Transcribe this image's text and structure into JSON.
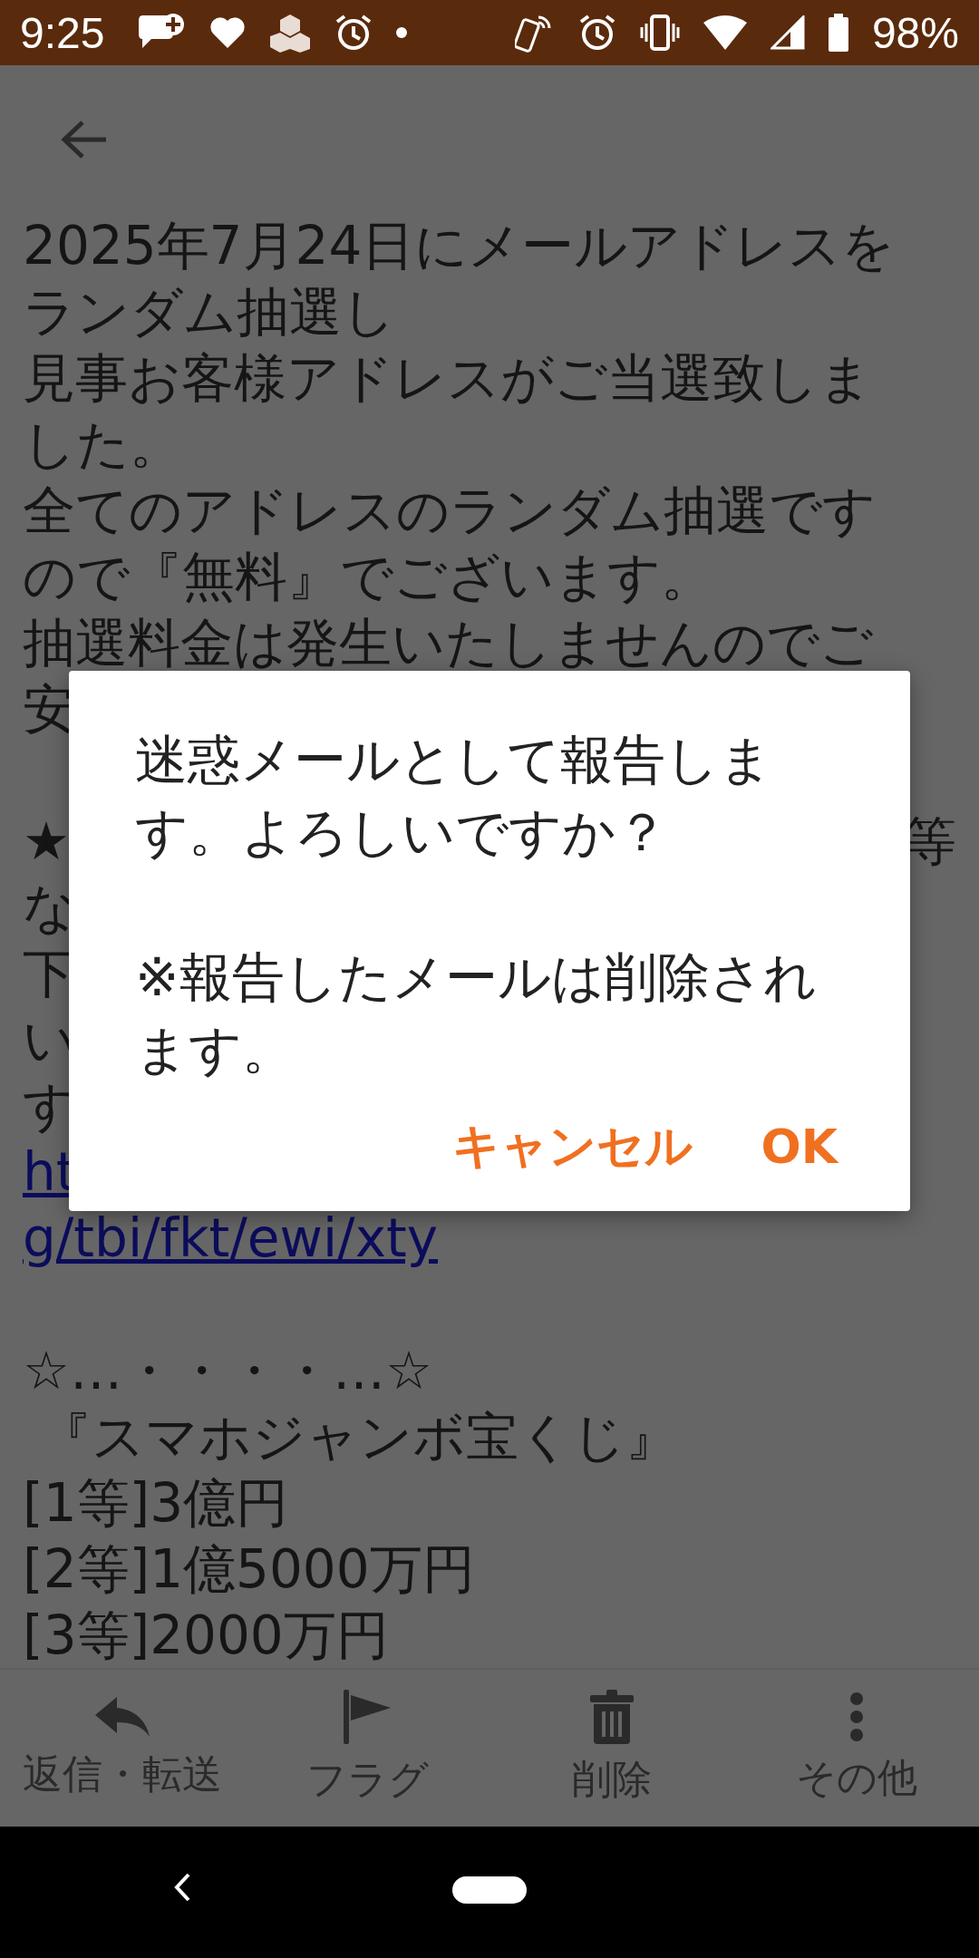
{
  "status_bar": {
    "time": "9:25",
    "battery": "98%"
  },
  "body": {
    "paragraphs": [
      [
        {
          "text": "2025年7月24日にメールアドレスを",
          "link": false
        },
        {
          "text": "ランダム抽選し",
          "link": false
        },
        {
          "text": "見事お客様アドレスがご当選致しま",
          "link": false
        },
        {
          "text": "した。",
          "link": false
        },
        {
          "text": "全てのアドレスのランダム抽選です",
          "link": false
        },
        {
          "text": "ので『無料』でございます。",
          "link": false
        },
        {
          "text": "抽選料金は発生いたしませんのでご",
          "link": false
        },
        {
          "text": "安",
          "link": false
        }
      ],
      [
        {
          "text": "★",
          "right": "等",
          "link": false
        },
        {
          "text": "な",
          "link": false
        },
        {
          "text": "下",
          "link": false
        },
        {
          "text": "い",
          "link": false
        },
        {
          "text": "す",
          "link": false
        },
        {
          "text": "ht",
          "link": true
        },
        {
          "text": "g/tbi/fkt/ewi/xty",
          "link": true
        }
      ],
      [
        {
          "text": "☆…・・・・…☆",
          "link": false
        },
        {
          "text": " 『スマホジャンボ宝くじ』",
          "link": false
        },
        {
          "text": "[1等]3億円",
          "link": false
        },
        {
          "text": "[2等]1億5000万円",
          "link": false
        },
        {
          "text": "[3等]2000万円",
          "link": false
        }
      ]
    ]
  },
  "toolbar": [
    {
      "kind": "reply",
      "label": "返信・転送"
    },
    {
      "kind": "flag",
      "label": "フラグ"
    },
    {
      "kind": "delete",
      "label": "削除"
    },
    {
      "kind": "more",
      "label": "その他"
    }
  ],
  "dialog": {
    "messages": [
      [
        "迷惑メールとして報告しま",
        "す。よろしいですか？"
      ],
      [
        "※報告したメールは削除され",
        "ます。"
      ]
    ],
    "buttons": [
      "キャンセル",
      "OK"
    ]
  }
}
